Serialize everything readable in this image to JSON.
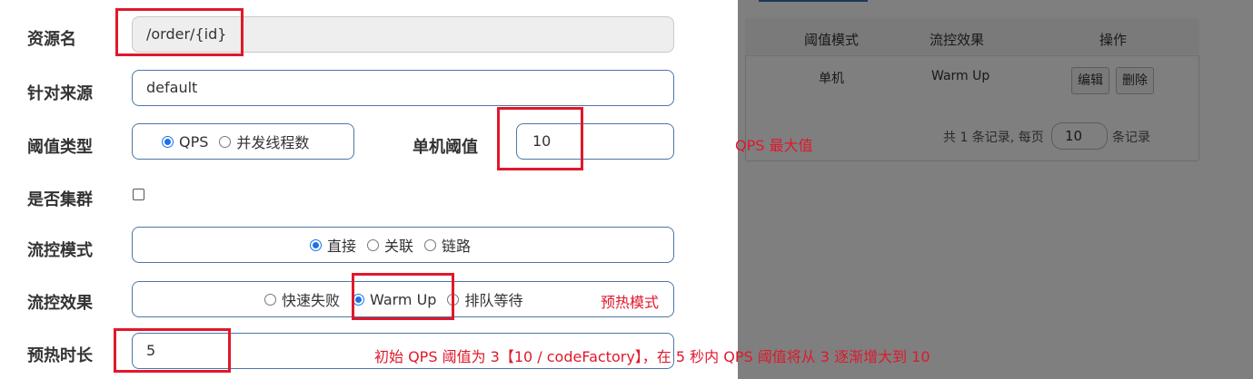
{
  "form": {
    "resource_label": "资源名",
    "resource_value": "/order/{id}",
    "source_label": "针对来源",
    "source_value": "default",
    "threshold_type_label": "阈值类型",
    "threshold_type_options": [
      "QPS",
      "并发线程数"
    ],
    "threshold_type_selected": "QPS",
    "single_threshold_label": "单机阈值",
    "single_threshold_value": "10",
    "cluster_label": "是否集群",
    "cluster_checked": false,
    "flow_mode_label": "流控模式",
    "flow_mode_options": [
      "直接",
      "关联",
      "链路"
    ],
    "flow_mode_selected": "直接",
    "flow_effect_label": "流控效果",
    "flow_effect_options": [
      "快速失败",
      "Warm Up",
      "排队等待"
    ],
    "flow_effect_selected": "Warm Up",
    "warmup_label": "预热时长",
    "warmup_value": "5"
  },
  "table": {
    "headers": [
      "阈值模式",
      "流控效果",
      "操作"
    ],
    "row": {
      "mode": "单机",
      "effect": "Warm Up"
    },
    "edit_label": "编辑",
    "delete_label": "删除",
    "pager_prefix": "共 1 条记录, 每页",
    "pager_size": "10",
    "pager_suffix": "条记录"
  },
  "annotations": {
    "qps_max": "QPS 最大值",
    "warmup_mode": "预热模式",
    "explanation": "初始 QPS 阈值为 3【10 / codeFactory】，在 5 秒内 QPS 阈值将从 3 逐渐增大到 10"
  },
  "colors": {
    "annotation_red": "#e0182b",
    "input_border": "#4b77a6",
    "radio_selected": "#1a73e8"
  }
}
